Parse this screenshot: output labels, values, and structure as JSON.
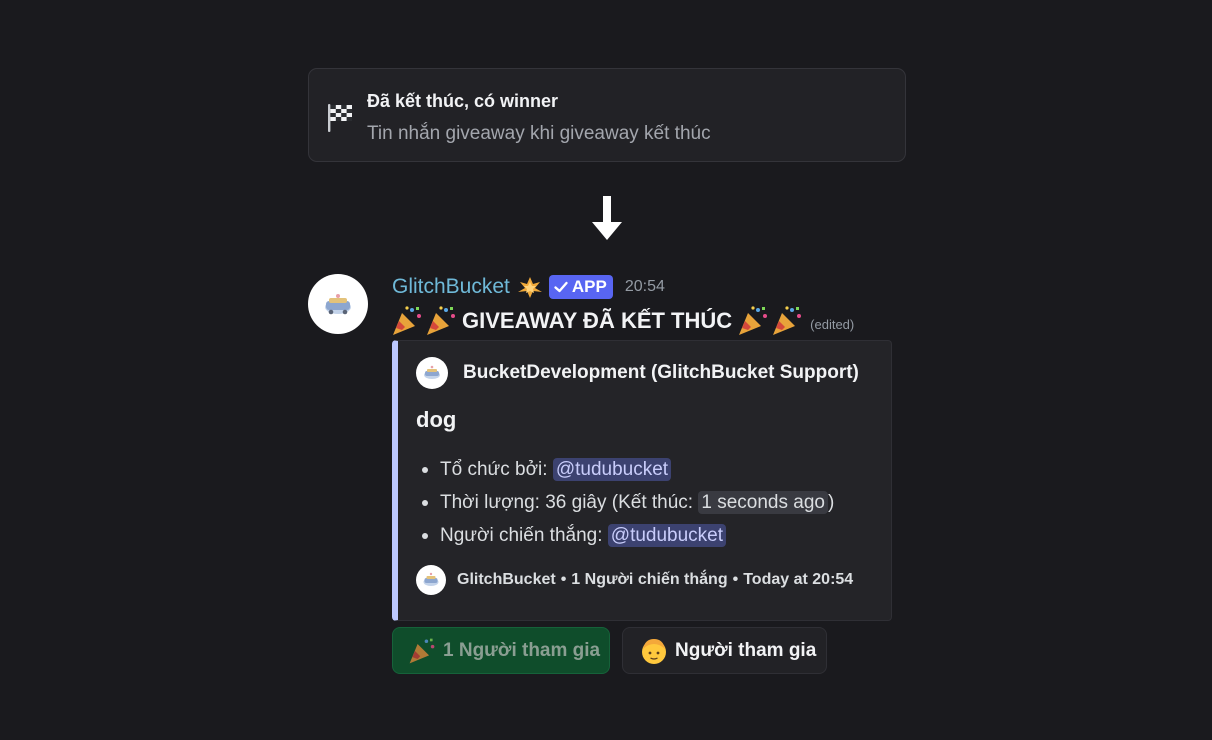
{
  "info_card": {
    "icon": "checkered-flag-icon",
    "title": "Đã kết thúc, có winner",
    "subtitle": "Tin nhắn giveaway khi giveaway kết thúc"
  },
  "message": {
    "username": "GlitchBucket",
    "badge_icon": "rank-badge-icon",
    "app_tag": "APP",
    "timestamp": "20:54",
    "title": "GIVEAWAY ĐÃ KẾT THÚC",
    "edited": "(edited)"
  },
  "embed": {
    "accent_color": "#bcc8ff",
    "author": "BucketDevelopment (GlitchBucket Support)",
    "title": "dog",
    "fields": {
      "organizer_label": "Tổ chức bởi: ",
      "organizer_mention": "@tudubucket",
      "duration_label": "Thời lượng: 36 giây (Kết thúc: ",
      "ended_time": "1 seconds ago",
      "duration_close": ")",
      "winner_label": "Người chiến thắng: ",
      "winner_mention": "@tudubucket"
    },
    "footer": {
      "bot": "GlitchBucket",
      "winners": "1 Người chiến thắng",
      "time": "Today at 20:54"
    }
  },
  "buttons": {
    "participants_label": "1 Người tham gia",
    "participants_color": "#0f4d2b",
    "join_label": "Người tham gia"
  }
}
